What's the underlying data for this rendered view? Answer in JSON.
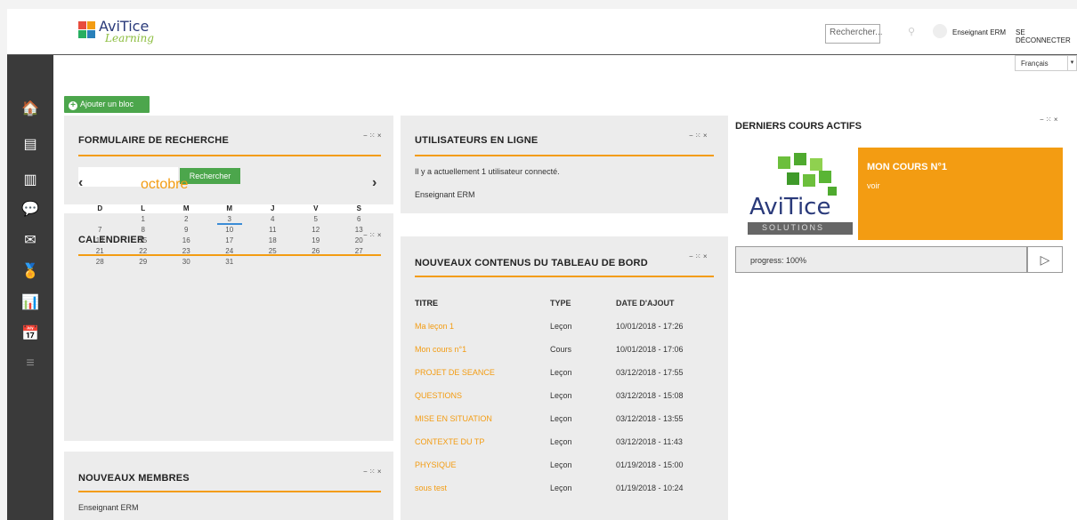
{
  "header": {
    "logo_name": "AviTice",
    "logo_sub": "Learning",
    "search_placeholder": "Rechercher...",
    "user_name": "Enseignant ERM",
    "logout_label": "SE DÉCONNECTER",
    "language": "Français"
  },
  "sidebar": {
    "items": [
      {
        "icon": "home-icon",
        "glyph": "🏠"
      },
      {
        "icon": "courses-icon",
        "glyph": "▤"
      },
      {
        "icon": "library-icon",
        "glyph": "▥"
      },
      {
        "icon": "messages-icon",
        "glyph": "💬"
      },
      {
        "icon": "mail-icon",
        "glyph": "✉"
      },
      {
        "icon": "badge-icon",
        "glyph": "🏅"
      },
      {
        "icon": "stats-icon",
        "glyph": "📊"
      },
      {
        "icon": "calendar-icon",
        "glyph": "📅"
      },
      {
        "icon": "menu-icon",
        "glyph": "≡"
      }
    ]
  },
  "add_block_label": "Ajouter un bloc",
  "controls_label": "− ⁙ ×",
  "search_block": {
    "title": "FORMULAIRE DE RECHERCHE",
    "button_label": "Rechercher"
  },
  "online_users": {
    "title": "UTILISATEURS EN LIGNE",
    "status": "Il y a actuellement 1 utilisateur connecté.",
    "user": "Enseignant ERM"
  },
  "calendar": {
    "title": "CALENDRIER",
    "month": "octobre",
    "prev": "‹",
    "next": "›",
    "days_of_week": [
      "D",
      "L",
      "M",
      "M",
      "J",
      "V",
      "S"
    ],
    "weeks": [
      [
        "",
        "1",
        "2",
        "3",
        "4",
        "5",
        "6"
      ],
      [
        "7",
        "8",
        "9",
        "10",
        "11",
        "12",
        "13"
      ],
      [
        "14",
        "15",
        "16",
        "17",
        "18",
        "19",
        "20"
      ],
      [
        "21",
        "22",
        "23",
        "24",
        "25",
        "26",
        "27"
      ],
      [
        "28",
        "29",
        "30",
        "31",
        "",
        "",
        ""
      ]
    ],
    "today": "3"
  },
  "new_members": {
    "title": "NOUVEAUX MEMBRES",
    "member": "Enseignant ERM"
  },
  "dashboard_content": {
    "title": "NOUVEAUX CONTENUS DU TABLEAU DE BORD",
    "headers": [
      "TITRE",
      "TYPE",
      "DATE D'AJOUT"
    ],
    "rows": [
      [
        "Ma leçon 1",
        "Leçon",
        "10/01/2018 - 17:26"
      ],
      [
        "Mon cours n°1",
        "Cours",
        "10/01/2018 - 17:06"
      ],
      [
        "PROJET DE SEANCE",
        "Leçon",
        "03/12/2018 - 17:55"
      ],
      [
        "QUESTIONS",
        "Leçon",
        "03/12/2018 - 15:08"
      ],
      [
        "MISE EN SITUATION",
        "Leçon",
        "03/12/2018 - 13:55"
      ],
      [
        "CONTEXTE DU TP",
        "Leçon",
        "03/12/2018 - 11:43"
      ],
      [
        "PHYSIQUE",
        "Leçon",
        "01/19/2018 - 15:00"
      ],
      [
        "sous test",
        "Leçon",
        "01/19/2018 - 10:24"
      ]
    ]
  },
  "recent_courses": {
    "title": "DERNIERS COURS ACTIFS",
    "course_name": "MON COURS N°1",
    "view_link": "voir",
    "progress": "progress: 100%",
    "image_text": "AviTice",
    "image_sub": "SOLUTIONS"
  },
  "colors": {
    "accent": "#f39c12",
    "green": "#4ca64c",
    "sidebar": "#3a3a3a"
  }
}
